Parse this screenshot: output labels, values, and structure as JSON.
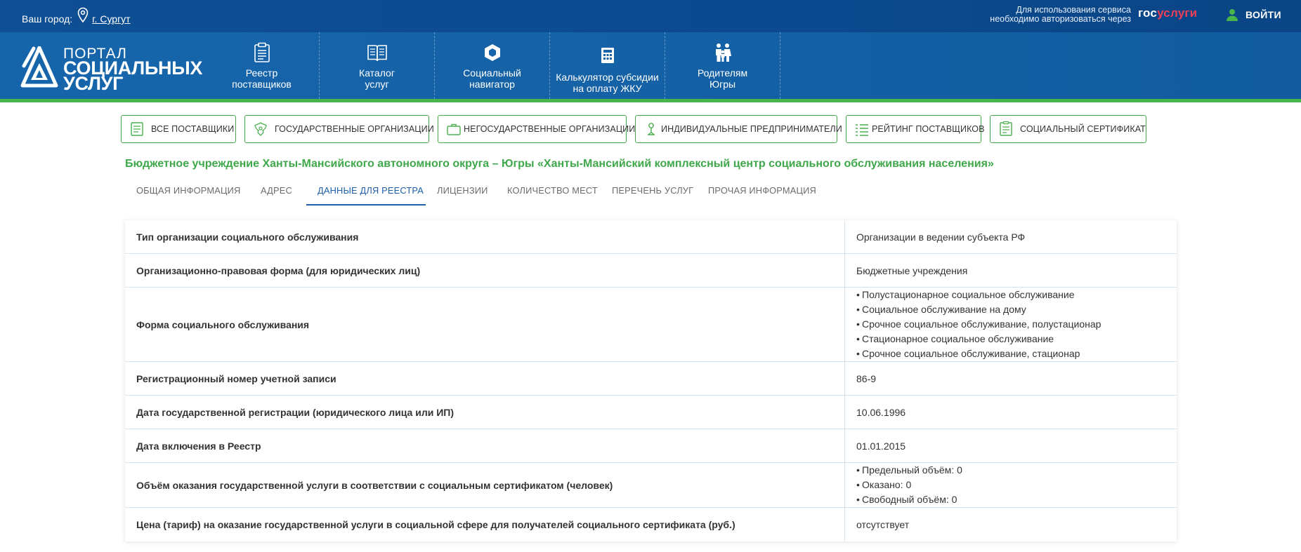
{
  "topbar": {
    "city_label": "Ваш город:",
    "city_name": "г. Сургут",
    "auth_note_line1": "Для использования сервиса",
    "auth_note_line2": "необходимо авторизоваться через",
    "gosuslugi_gos": "гос",
    "gosuslugi_uslugi": "услуги",
    "login_label": "ВОЙТИ"
  },
  "logo": {
    "line1": "ПОРТАЛ",
    "line2": "СОЦИАЛЬНЫХ",
    "line3": "УСЛУГ"
  },
  "nav": [
    {
      "line1": "Реестр",
      "line2": "поставщиков",
      "icon": "clipboard-icon"
    },
    {
      "line1": "Каталог",
      "line2": "услуг",
      "icon": "book-icon"
    },
    {
      "line1": "Социальный",
      "line2": "навигатор",
      "icon": "hexagon-icon"
    },
    {
      "line1": "Калькулятор субсидии",
      "line2": "на оплату ЖКУ",
      "icon": "calculator-icon"
    },
    {
      "line1": "Родителям",
      "line2": "Югры",
      "icon": "family-icon"
    }
  ],
  "filters": [
    {
      "label": "ВСЕ ПОСТАВЩИКИ",
      "icon": "list-icon"
    },
    {
      "label": "ГОСУДАРСТВЕННЫЕ ОРГАНИЗАЦИИ",
      "icon": "emblem-icon"
    },
    {
      "label": "НЕГОСУДАРСТВЕННЫЕ ОРГАНИЗАЦИИ",
      "icon": "briefcase-icon"
    },
    {
      "label": "ИНДИВИДУАЛЬНЫЕ ПРЕДПРИНИМАТЕЛИ",
      "icon": "person-icon"
    },
    {
      "label": "РЕЙТИНГ ПОСТАВЩИКОВ",
      "icon": "rating-list-icon"
    },
    {
      "label": "СОЦИАЛЬНЫЙ СЕРТИФИКАТ",
      "icon": "certificate-icon"
    }
  ],
  "org_title": "Бюджетное учреждение Ханты-Мансийского автономного округа – Югры «Ханты-Мансийский комплексный центр социального обслуживания населения»",
  "tabs": [
    {
      "label": "ОБЩАЯ ИНФОРМАЦИЯ"
    },
    {
      "label": "АДРЕС"
    },
    {
      "label": "ДАННЫЕ ДЛЯ РЕЕСТРА"
    },
    {
      "label": "ЛИЦЕНЗИИ"
    },
    {
      "label": "КОЛИЧЕСТВО МЕСТ"
    },
    {
      "label": "ПЕРЕЧЕНЬ УСЛУГ"
    },
    {
      "label": "ПРОЧАЯ ИНФОРМАЦИЯ"
    }
  ],
  "active_tab": "ДАННЫЕ ДЛЯ РЕЕСТРА",
  "rows": [
    {
      "key": "Тип организации социального обслуживания",
      "value": "Организации в ведении субъекта РФ"
    },
    {
      "key": "Организационно-правовая форма (для юридических лиц)",
      "value": "Бюджетные учреждения"
    },
    {
      "key": "Форма социального обслуживания",
      "list": [
        "Полустационарное социальное обслуживание",
        "Социальное обслуживание на дому",
        "Срочное социальное обслуживание, полустационар",
        "Стационарное социальное обслуживание",
        "Срочное социальное обслуживание, стационар"
      ]
    },
    {
      "key": "Регистрационный номер учетной записи",
      "value": "86-9"
    },
    {
      "key": "Дата государственной регистрации (юридического лица или ИП)",
      "value": "10.06.1996"
    },
    {
      "key": "Дата включения в Реестр",
      "value": "01.01.2015"
    },
    {
      "key": "Объём оказания государственной услуги в соответствии с социальным сертификатом (человек)",
      "list": [
        "Предельный объём: 0",
        "Оказано: 0",
        "Свободный объём: 0"
      ]
    },
    {
      "key": "Цена (тариф) на оказание государственной услуги в социальной сфере для получателей социального сертификата (руб.)",
      "value": "отсутствует"
    }
  ],
  "colors": {
    "topbar": "#0f4f93",
    "header": "#1665ab",
    "accent_green": "#48b54a",
    "active_tab": "#1e5fa8",
    "gosuslugi_red": "#ee3f58"
  }
}
